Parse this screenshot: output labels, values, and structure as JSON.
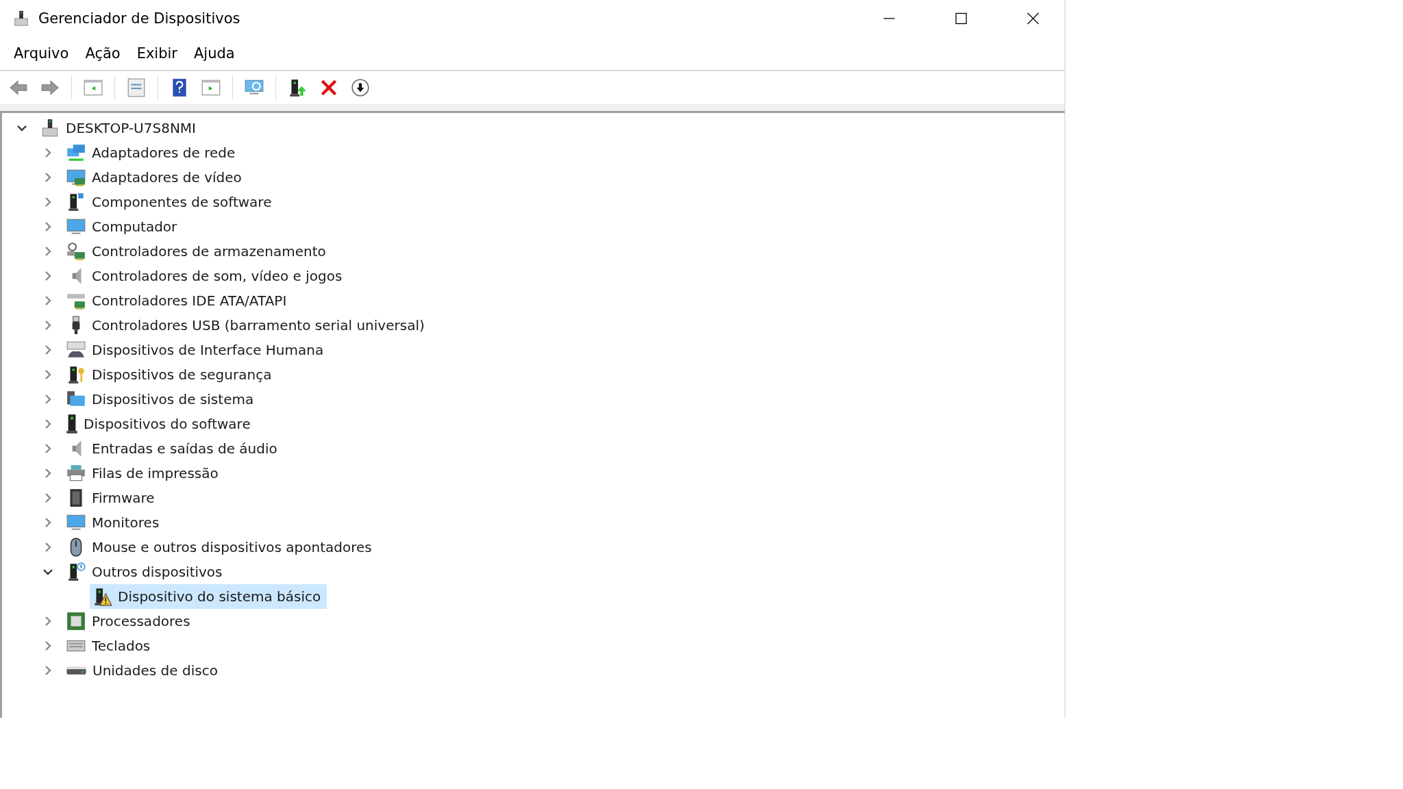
{
  "window": {
    "title": "Gerenciador de Dispositivos"
  },
  "menu": [
    "Arquivo",
    "Ação",
    "Exibir",
    "Ajuda"
  ],
  "tree": {
    "label": "DESKTOP-U7S8NMI",
    "expanded": true,
    "selected": false,
    "children": [
      {
        "label": "Adaptadores de rede",
        "expanded": false,
        "selected": false
      },
      {
        "label": "Adaptadores de vídeo",
        "expanded": false,
        "selected": false
      },
      {
        "label": "Componentes de software",
        "expanded": false,
        "selected": false
      },
      {
        "label": "Computador",
        "expanded": false,
        "selected": false
      },
      {
        "label": "Controladores de armazenamento",
        "expanded": false,
        "selected": false
      },
      {
        "label": "Controladores de som, vídeo e jogos",
        "expanded": false,
        "selected": false
      },
      {
        "label": "Controladores IDE ATA/ATAPI",
        "expanded": false,
        "selected": false
      },
      {
        "label": "Controladores USB (barramento serial universal)",
        "expanded": false,
        "selected": false
      },
      {
        "label": "Dispositivos de Interface Humana",
        "expanded": false,
        "selected": false
      },
      {
        "label": "Dispositivos de segurança",
        "expanded": false,
        "selected": false
      },
      {
        "label": "Dispositivos de sistema",
        "expanded": false,
        "selected": false
      },
      {
        "label": "Dispositivos do software",
        "expanded": false,
        "selected": false
      },
      {
        "label": "Entradas e saídas de áudio",
        "expanded": false,
        "selected": false
      },
      {
        "label": "Filas de impressão",
        "expanded": false,
        "selected": false
      },
      {
        "label": "Firmware",
        "expanded": false,
        "selected": false
      },
      {
        "label": "Monitores",
        "expanded": false,
        "selected": false
      },
      {
        "label": "Mouse e outros dispositivos apontadores",
        "expanded": false,
        "selected": false
      },
      {
        "label": "Outros dispositivos",
        "expanded": true,
        "selected": false,
        "children": [
          {
            "label": "Dispositivo do sistema básico",
            "selected": true
          }
        ]
      },
      {
        "label": "Processadores",
        "expanded": false,
        "selected": false
      },
      {
        "label": "Teclados",
        "expanded": false,
        "selected": false
      },
      {
        "label": "Unidades de disco",
        "expanded": false,
        "selected": false
      }
    ]
  }
}
